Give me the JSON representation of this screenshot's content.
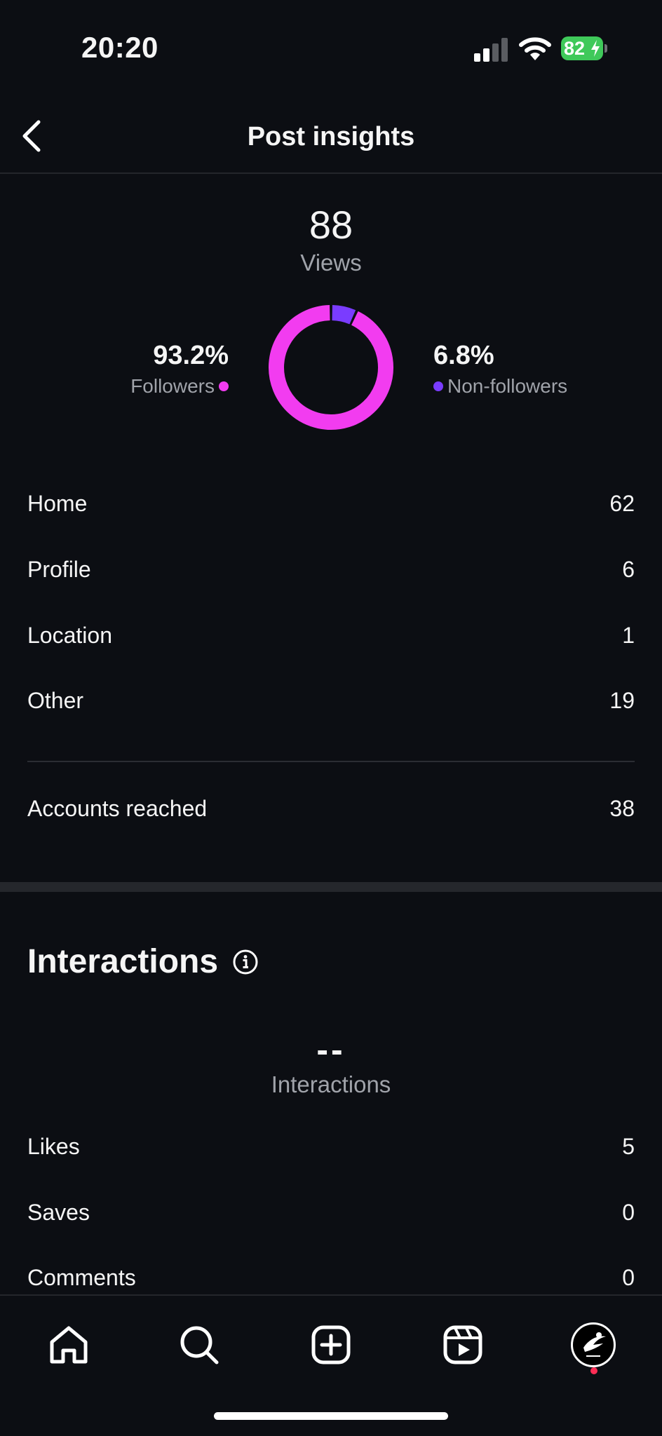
{
  "status_bar": {
    "time": "20:20",
    "battery_level": "82",
    "battery_color": "#3fc95a"
  },
  "header": {
    "title": "Post insights",
    "back_icon": "chevron-left-icon"
  },
  "views": {
    "count": "88",
    "label": "Views",
    "followers_pct": "93.2%",
    "followers_label": "Followers",
    "non_followers_pct": "6.8%",
    "non_followers_label": "Non-followers",
    "followers_share": 0.932,
    "non_followers_share": 0.068,
    "followers_color": "#f23cf0",
    "non_followers_color": "#7a3cff"
  },
  "sources": [
    {
      "label": "Home",
      "value": "62"
    },
    {
      "label": "Profile",
      "value": "6"
    },
    {
      "label": "Location",
      "value": "1"
    },
    {
      "label": "Other",
      "value": "19"
    }
  ],
  "reach": {
    "label": "Accounts reached",
    "value": "38"
  },
  "interactions": {
    "title": "Interactions",
    "count": "--",
    "label": "Interactions",
    "rows": [
      {
        "label": "Likes",
        "value": "5"
      },
      {
        "label": "Saves",
        "value": "0"
      },
      {
        "label": "Comments",
        "value": "0"
      }
    ]
  },
  "bottom_nav": {
    "items": [
      "home-icon",
      "search-icon",
      "create-post-icon",
      "reels-icon",
      "profile-avatar"
    ]
  }
}
